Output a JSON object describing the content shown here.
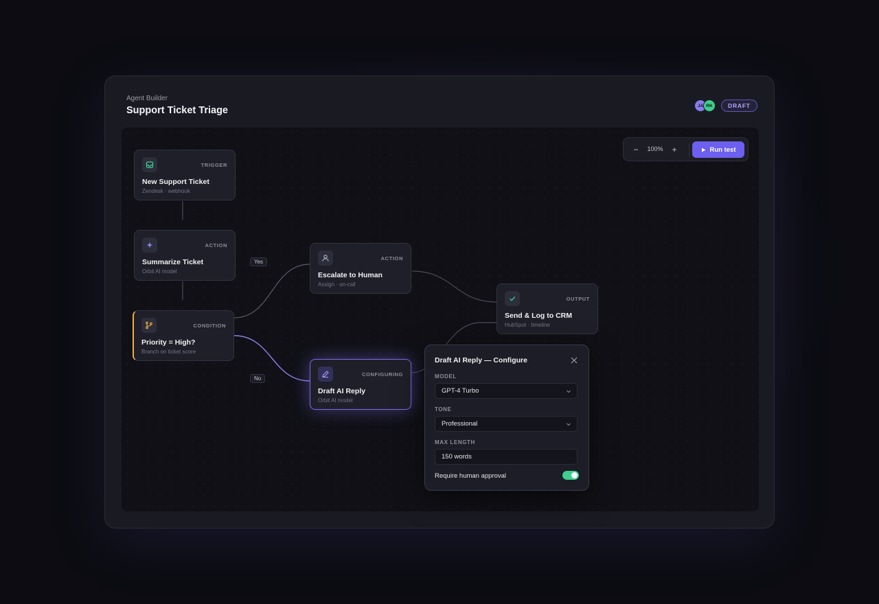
{
  "header": {
    "kicker": "Agent Builder",
    "title": "Support Ticket Triage",
    "collaborators": [
      "JA",
      "RK"
    ],
    "status_badge": "DRAFT"
  },
  "toolbar": {
    "zoom_out": "−",
    "zoom_level": "100%",
    "zoom_in": "+",
    "run_label": "Run test"
  },
  "nodes": {
    "trigger": {
      "type": "TRIGGER",
      "title": "New Support Ticket",
      "subtitle": "Zendesk · webhook",
      "icon": "inbox-icon"
    },
    "summarize": {
      "type": "ACTION",
      "title": "Summarize Ticket",
      "subtitle": "Orbit AI model",
      "icon": "sparkle-icon"
    },
    "condition": {
      "type": "CONDITION",
      "title": "Priority = High?",
      "subtitle": "Branch on ticket score",
      "icon": "branch-icon"
    },
    "escalate": {
      "type": "ACTION",
      "title": "Escalate to Human",
      "subtitle": "Assign · on-call",
      "icon": "user-icon"
    },
    "draft": {
      "type": "CONFIGURING",
      "title": "Draft AI Reply",
      "subtitle": "Orbit AI model",
      "icon": "pencil-icon"
    },
    "output": {
      "type": "OUTPUT",
      "title": "Send & Log to CRM",
      "subtitle": "HubSpot · timeline",
      "icon": "check-icon"
    }
  },
  "edge_labels": {
    "yes": "Yes",
    "no": "No"
  },
  "panel": {
    "title": "Draft AI Reply — Configure",
    "model_label": "MODEL",
    "model_value": "GPT-4 Turbo",
    "tone_label": "TONE",
    "tone_value": "Professional",
    "max_length_label": "MAX LENGTH",
    "max_length_value": "150 words",
    "approval_label": "Require human approval",
    "approval_enabled": true
  },
  "colors": {
    "accent": "#6d5ff0",
    "condition": "#f0b040",
    "toggle_on": "#3ecf8e"
  }
}
